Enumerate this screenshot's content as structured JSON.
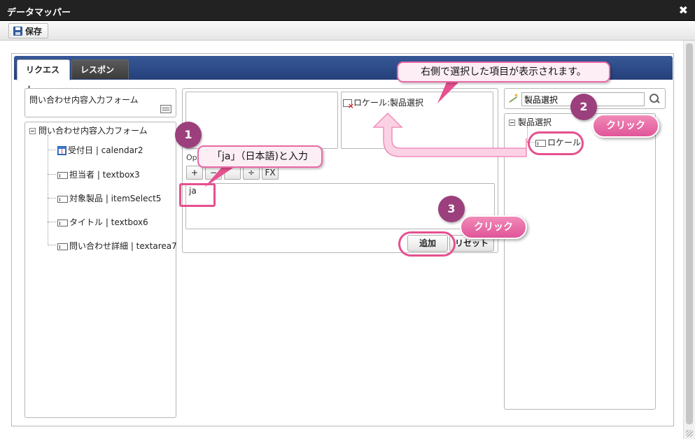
{
  "window": {
    "title": "データマッパー"
  },
  "toolbar": {
    "save_label": "保存"
  },
  "tabs": [
    {
      "label": "リクエスト",
      "active": true
    },
    {
      "label": "レスポンス",
      "active": false
    }
  ],
  "left_panel": {
    "form_title": "問い合わせ内容入力フォーム",
    "tree_root": "問い合わせ内容入力フォーム",
    "items": [
      {
        "label": "受付日 | calendar2",
        "icon": "calendar-icon"
      },
      {
        "label": "担当者 | textbox3",
        "icon": "textbox-icon"
      },
      {
        "label": "対象製品 | itemSelect5",
        "icon": "textbox-icon"
      },
      {
        "label": "タイトル | textbox6",
        "icon": "textbox-icon"
      },
      {
        "label": "問い合わせ詳細 | textarea7",
        "icon": "textbox-icon"
      }
    ]
  },
  "center": {
    "mapped_target": "ロケール:製品選択",
    "operators_label": "Op",
    "operators": [
      "+",
      "−",
      "",
      "÷",
      "FX"
    ],
    "expression": "ja",
    "add_label": "追加",
    "reset_label": "リセット"
  },
  "right_panel": {
    "search_value": "製品選択",
    "tree_root": "製品選択",
    "items": [
      {
        "label": "ロケール"
      }
    ]
  },
  "annotations": {
    "note_top": "右側で選択した項目が表示されます。",
    "note_input": "「ja」（日本語)と入力",
    "step1": "1",
    "step2": "2",
    "step3": "3",
    "click2": "クリック",
    "click3": "クリック"
  },
  "colors": {
    "titlebar": "#222222",
    "tabstrip": "#2f4f8c",
    "annotation_pink": "#e6508f",
    "step_circle": "#9b3f7d"
  }
}
